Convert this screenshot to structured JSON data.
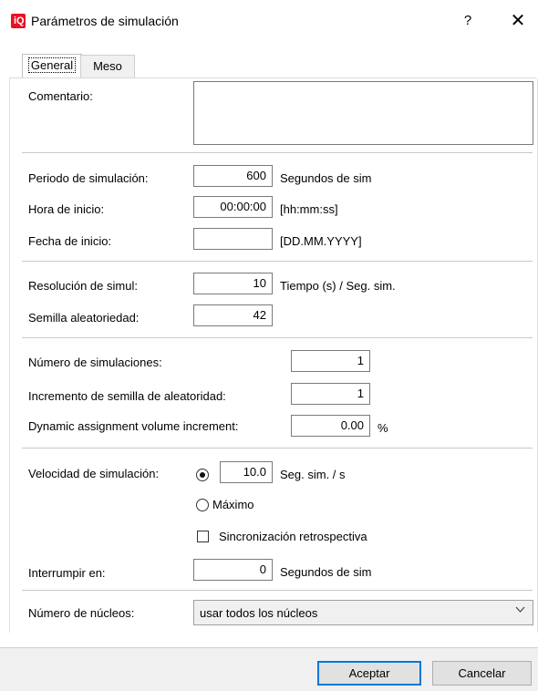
{
  "window": {
    "app_icon_label": "iQ",
    "title": "Parámetros de simulación",
    "help_label": "?",
    "close_label": "✕"
  },
  "tabs": [
    {
      "label": "General",
      "active": true
    },
    {
      "label": "Meso",
      "active": false
    }
  ],
  "general": {
    "comment_label": "Comentario:",
    "comment_value": "",
    "period_label": "Periodo de simulación:",
    "period_value": "600",
    "period_unit": "Segundos de sim",
    "start_time_label": "Hora de inicio:",
    "start_time_value": "00:00:00",
    "start_time_unit": "[hh:mm:ss]",
    "start_date_label": "Fecha de inicio:",
    "start_date_value": "",
    "start_date_unit": "[DD.MM.YYYY]",
    "resolution_label": "Resolución de simul:",
    "resolution_value": "10",
    "resolution_unit": "Tiempo (s) / Seg. sim.",
    "seed_label": "Semilla aleatoriedad:",
    "seed_value": "42",
    "num_runs_label": "Número de simulaciones:",
    "num_runs_value": "1",
    "seed_increment_label": "Incremento de semilla de aleatoridad:",
    "seed_increment_value": "1",
    "dyn_volume_label": "Dynamic assignment volume increment:",
    "dyn_volume_value": "0.00",
    "dyn_volume_unit": "%",
    "speed_label": "Velocidad de simulación:",
    "speed_value": "10.0",
    "speed_unit": "Seg. sim. / s",
    "speed_fixed_selected": true,
    "max_label": "Máximo",
    "max_selected": false,
    "retro_sync_label": "Sincronización retrospectiva",
    "retro_sync_checked": false,
    "break_at_label": "Interrumpir en:",
    "break_at_value": "0",
    "break_at_unit": "Segundos de sim",
    "cores_label": "Número de núcleos:",
    "cores_value": "usar todos los núcleos"
  },
  "buttons": {
    "ok": "Aceptar",
    "cancel": "Cancelar"
  },
  "colors": {
    "accent": "#0078d7",
    "app_icon": "#e81123"
  },
  "icons": {
    "dropdown": "chevron-down-icon"
  }
}
